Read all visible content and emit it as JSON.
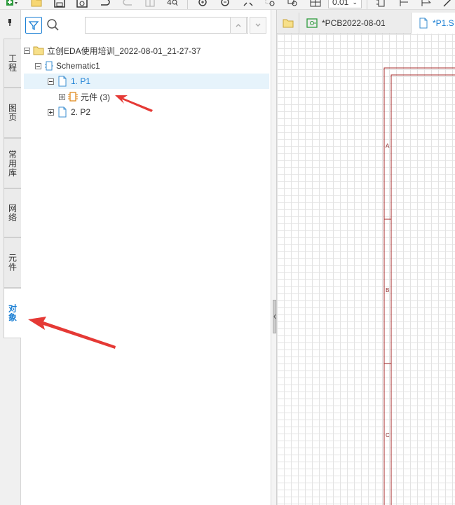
{
  "toolbar": {
    "zoom_value": "0.01",
    "icons": [
      "add-icon",
      "folder-icon",
      "save-icon",
      "save-all-icon",
      "undo-icon",
      "redo-icon",
      "grid-icon",
      "search-replace-icon",
      "zoom-in-icon",
      "zoom-out-icon",
      "fit-icon",
      "zoom-area-icon",
      "table-icon",
      "dropdown-icon",
      "component-icon",
      "align-icon",
      "line-icon"
    ]
  },
  "side_tabs": [
    {
      "label": "工程",
      "active": false
    },
    {
      "label": "图页",
      "active": false
    },
    {
      "label": "常用库",
      "active": false
    },
    {
      "label": "网络",
      "active": false
    },
    {
      "label": "元件",
      "active": false
    },
    {
      "label": "对象",
      "active": true
    }
  ],
  "panel": {
    "search_value": "",
    "tree": [
      {
        "label": "立创EDA使用培训_2022-08-01_21-27-37",
        "icon": "folder-icon",
        "level": 0
      },
      {
        "label": "Schematic1",
        "icon": "schematic-icon",
        "level": 1
      },
      {
        "label": "1. P1",
        "icon": "page-icon",
        "level": 2,
        "selected": true
      },
      {
        "label": "元件 (3)",
        "icon": "chip-icon",
        "level": 3
      },
      {
        "label": "2. P2",
        "icon": "page-icon",
        "level": 2
      }
    ]
  },
  "doc_tabs": [
    {
      "label": "",
      "icon": "folder-icon",
      "active": false
    },
    {
      "label": "*PCB2022-08-01",
      "icon": "pcb-icon",
      "active": false
    },
    {
      "label": "*P1.S",
      "icon": "page-icon",
      "active": true
    }
  ],
  "canvas": {
    "zone_labels": [
      "A",
      "B",
      "C"
    ],
    "frame_color": "#a52a2a",
    "grid_color": "#e3e3e3"
  },
  "colors": {
    "accent": "#1a7fd4",
    "annotation_arrow": "#e53935",
    "selection_bg": "#e6f3fb"
  }
}
